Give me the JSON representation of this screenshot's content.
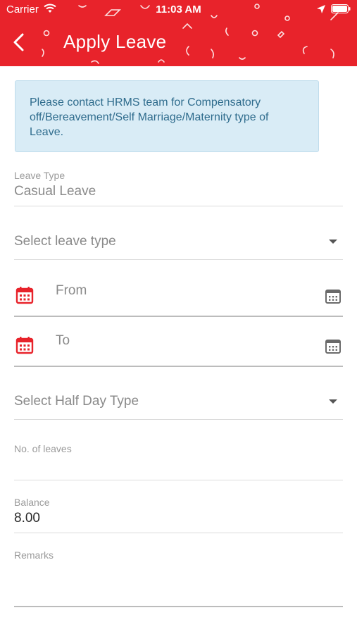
{
  "status_bar": {
    "carrier": "Carrier",
    "time": "11:03 AM"
  },
  "header": {
    "title": "Apply Leave"
  },
  "notice": {
    "text": "Please contact HRMS team for Compensatory off/Bereavement/Self Marriage/Maternity type of Leave."
  },
  "leave_type": {
    "label": "Leave Type",
    "value": "Casual Leave"
  },
  "select_leave_type": {
    "placeholder": "Select leave type"
  },
  "from_date": {
    "placeholder": "From"
  },
  "to_date": {
    "placeholder": "To"
  },
  "half_day": {
    "placeholder": "Select Half Day Type"
  },
  "no_of_leaves": {
    "label": "No. of leaves"
  },
  "balance": {
    "label": "Balance",
    "value": "8.00"
  },
  "remarks": {
    "label": "Remarks"
  },
  "colors": {
    "primary": "#e8232b",
    "notice_bg": "#d9ecf6",
    "notice_text": "#2f6c8d"
  }
}
